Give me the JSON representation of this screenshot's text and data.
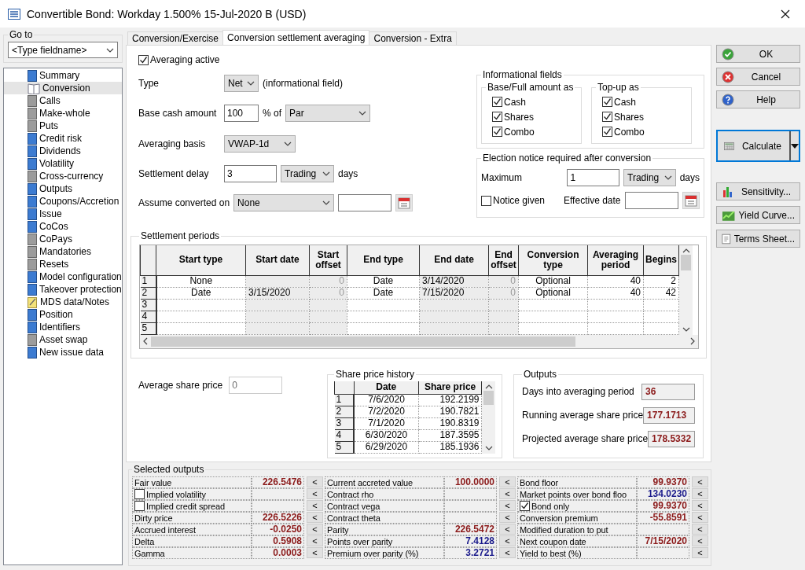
{
  "window": {
    "title": "Convertible Bond: Workday 1.500% 15-Jul-2020 B (USD)"
  },
  "goto": {
    "label": "Go to",
    "value": "<Type fieldname>"
  },
  "sidebar": {
    "items": [
      {
        "label": "Summary",
        "kind": "blue",
        "selected": false
      },
      {
        "label": "Conversion",
        "kind": "book",
        "selected": true
      },
      {
        "label": "Calls",
        "kind": "gray",
        "selected": false
      },
      {
        "label": "Make-whole",
        "kind": "gray",
        "selected": false
      },
      {
        "label": "Puts",
        "kind": "gray",
        "selected": false
      },
      {
        "label": "Credit risk",
        "kind": "blue",
        "selected": false
      },
      {
        "label": "Dividends",
        "kind": "blue",
        "selected": false
      },
      {
        "label": "Volatility",
        "kind": "blue",
        "selected": false
      },
      {
        "label": "Cross-currency",
        "kind": "gray",
        "selected": false
      },
      {
        "label": "Outputs",
        "kind": "blue",
        "selected": false
      },
      {
        "label": "Coupons/Accretion",
        "kind": "blue",
        "selected": false
      },
      {
        "label": "Issue",
        "kind": "blue",
        "selected": false
      },
      {
        "label": "CoCos",
        "kind": "blue",
        "selected": false
      },
      {
        "label": "CoPays",
        "kind": "gray",
        "selected": false
      },
      {
        "label": "Mandatories",
        "kind": "gray",
        "selected": false
      },
      {
        "label": "Resets",
        "kind": "gray",
        "selected": false
      },
      {
        "label": "Model configuration",
        "kind": "blue",
        "selected": false
      },
      {
        "label": "Takeover protection",
        "kind": "blue",
        "selected": false
      },
      {
        "label": "MDS data/Notes",
        "kind": "note",
        "selected": false
      },
      {
        "label": "Position",
        "kind": "blue",
        "selected": false
      },
      {
        "label": "Identifiers",
        "kind": "blue",
        "selected": false
      },
      {
        "label": "Asset swap",
        "kind": "gray",
        "selected": false
      },
      {
        "label": "New issue data",
        "kind": "blue",
        "selected": false
      }
    ]
  },
  "tabs": [
    {
      "label": "Conversion/Exercise",
      "selected": false
    },
    {
      "label": "Conversion settlement averaging",
      "selected": true
    },
    {
      "label": "Conversion - Extra",
      "selected": false
    }
  ],
  "averaging": {
    "label": "Averaging active",
    "checked": true
  },
  "type": {
    "label": "Type",
    "value": "Net",
    "note": "(informational field)"
  },
  "base_cash": {
    "label": "Base cash amount",
    "value": "100",
    "unit": "% of",
    "basis": "Par"
  },
  "averaging_basis": {
    "label": "Averaging basis",
    "value": "VWAP-1d"
  },
  "settlement_delay": {
    "label": "Settlement delay",
    "value": "3",
    "unit": "Trading",
    "suffix": "days"
  },
  "assume_converted": {
    "label": "Assume converted on",
    "value": "None"
  },
  "informational": {
    "title": "Informational fields",
    "groups": [
      {
        "title": "Base/Full amount as",
        "options": [
          {
            "label": "Cash",
            "checked": true
          },
          {
            "label": "Shares",
            "checked": true
          },
          {
            "label": "Combo",
            "checked": true
          }
        ]
      },
      {
        "title": "Top-up as",
        "options": [
          {
            "label": "Cash",
            "checked": true
          },
          {
            "label": "Shares",
            "checked": true
          },
          {
            "label": "Combo",
            "checked": true
          }
        ]
      }
    ]
  },
  "election": {
    "title": "Election notice required after conversion",
    "maximum_label": "Maximum",
    "maximum": "1",
    "unit": "Trading",
    "suffix": "days",
    "notice": {
      "label": "Notice given",
      "checked": false
    },
    "effective_label": "Effective date"
  },
  "buttons": [
    {
      "label": "OK",
      "kind": "ok"
    },
    {
      "label": "Cancel",
      "kind": "cancel"
    },
    {
      "label": "Help",
      "kind": "help"
    }
  ],
  "calculate": {
    "label": "Calculate"
  },
  "tools": [
    {
      "label": "Sensitivity...",
      "kind": "bars"
    },
    {
      "label": "Yield Curve...",
      "kind": "curve"
    },
    {
      "label": "Terms Sheet...",
      "kind": "sheet"
    }
  ],
  "settlement": {
    "title": "Settlement periods",
    "columns": [
      {
        "label": "Start type",
        "shaded": false
      },
      {
        "label": "Start date",
        "shaded": true
      },
      {
        "label": "Start offset",
        "shaded": true
      },
      {
        "label": "End type",
        "shaded": false
      },
      {
        "label": "End date",
        "shaded": true
      },
      {
        "label": "End offset",
        "shaded": true
      },
      {
        "label": "Conversion type",
        "shaded": false
      },
      {
        "label": "Averaging period",
        "shaded": false
      },
      {
        "label": "Begins",
        "shaded": false
      }
    ],
    "rows": [
      {
        "number": "1",
        "cells": [
          "None",
          null,
          "0",
          "Date",
          "3/14/2020",
          "0",
          "Optional",
          "40",
          "2"
        ]
      },
      {
        "number": "2",
        "cells": [
          "Date",
          "3/15/2020",
          "0",
          "Date",
          "7/15/2020",
          "0",
          "Optional",
          "40",
          "42"
        ]
      },
      {
        "number": "3"
      },
      {
        "number": "4"
      },
      {
        "number": "5"
      }
    ]
  },
  "average_share_price": {
    "label": "Average share price",
    "value": "0",
    "disabled": true
  },
  "history": {
    "title": "Share price history",
    "columns": [
      "Date",
      "Share price"
    ],
    "rows": [
      {
        "number": "1",
        "date": "7/6/2020",
        "price": "192.2199"
      },
      {
        "number": "2",
        "date": "7/2/2020",
        "price": "190.7821"
      },
      {
        "number": "3",
        "date": "7/1/2020",
        "price": "190.8319"
      },
      {
        "number": "4",
        "date": "6/30/2020",
        "price": "187.3595"
      },
      {
        "number": "5",
        "date": "6/29/2020",
        "price": "185.1936"
      }
    ]
  },
  "outputs": {
    "title": "Outputs",
    "items": [
      {
        "label": "Days into averaging period",
        "value": "36"
      },
      {
        "label": "Running average share price",
        "value": "177.1713"
      },
      {
        "label": "Projected average share price",
        "value": "178.5332"
      }
    ]
  },
  "selected_outputs": {
    "title": "Selected outputs",
    "columns": [
      [
        {
          "kind": "label",
          "label": "Fair value",
          "value": "226.5476",
          "color": "#8b1a1a",
          "button": "<"
        },
        {
          "kind": "check",
          "label": "Implied volatility",
          "checked": false,
          "button": "<"
        },
        {
          "kind": "check",
          "label": "Implied credit spread",
          "checked": false,
          "button": "<"
        },
        {
          "kind": "label",
          "label": "Dirty price",
          "value": "226.5226",
          "color": "#8b1a1a",
          "button": "<"
        },
        {
          "kind": "label",
          "label": "Accrued interest",
          "value": "-0.0250",
          "color": "#8b1a1a",
          "button": "<"
        },
        {
          "kind": "label",
          "label": "Delta",
          "value": "0.5908",
          "color": "#8b1a1a",
          "button": "<"
        },
        {
          "kind": "label",
          "label": "Gamma",
          "value": "0.0003",
          "color": "#8b1a1a",
          "button": "<"
        }
      ],
      [
        {
          "kind": "label",
          "label": "Current accreted value",
          "value": "100.0000",
          "color": "#8b1a1a",
          "button": "<"
        },
        {
          "kind": "label",
          "label": "Contract rho",
          "button": "<"
        },
        {
          "kind": "label",
          "label": "Contract vega",
          "button": "<"
        },
        {
          "kind": "label",
          "label": "Contract theta",
          "button": "<"
        },
        {
          "kind": "label",
          "label": "Parity",
          "value": "226.5472",
          "color": "#8b1a1a",
          "button": "<"
        },
        {
          "kind": "label",
          "label": "Points over parity",
          "value": "7.4128",
          "color": "#1a1a8b",
          "button": "<"
        },
        {
          "kind": "label",
          "label": "Premium over parity (%)",
          "value": "3.2721",
          "color": "#1a1a8b",
          "button": "<"
        }
      ],
      [
        {
          "kind": "label",
          "label": "Bond floor",
          "value": "99.9370",
          "color": "#8b1a1a",
          "button": "<"
        },
        {
          "kind": "label",
          "label": "Market points over bond floo",
          "value": "134.0230",
          "color": "#1a1a8b",
          "button": "<"
        },
        {
          "kind": "check",
          "label": "Bond only",
          "checked": true,
          "value": "99.9370",
          "color": "#8b1a1a",
          "button": "<"
        },
        {
          "kind": "label",
          "label": "Conversion premium",
          "value": "-55.8591",
          "color": "#8b1a1a",
          "button": "<"
        },
        {
          "kind": "label",
          "label": "Modified duration to put",
          "button": "<"
        },
        {
          "kind": "label",
          "label": "Next coupon date",
          "value": "7/15/2020",
          "color": "#8b1a1a",
          "button": "<"
        },
        {
          "kind": "label",
          "label": "Yield to best (%)",
          "button": "<"
        }
      ]
    ]
  }
}
